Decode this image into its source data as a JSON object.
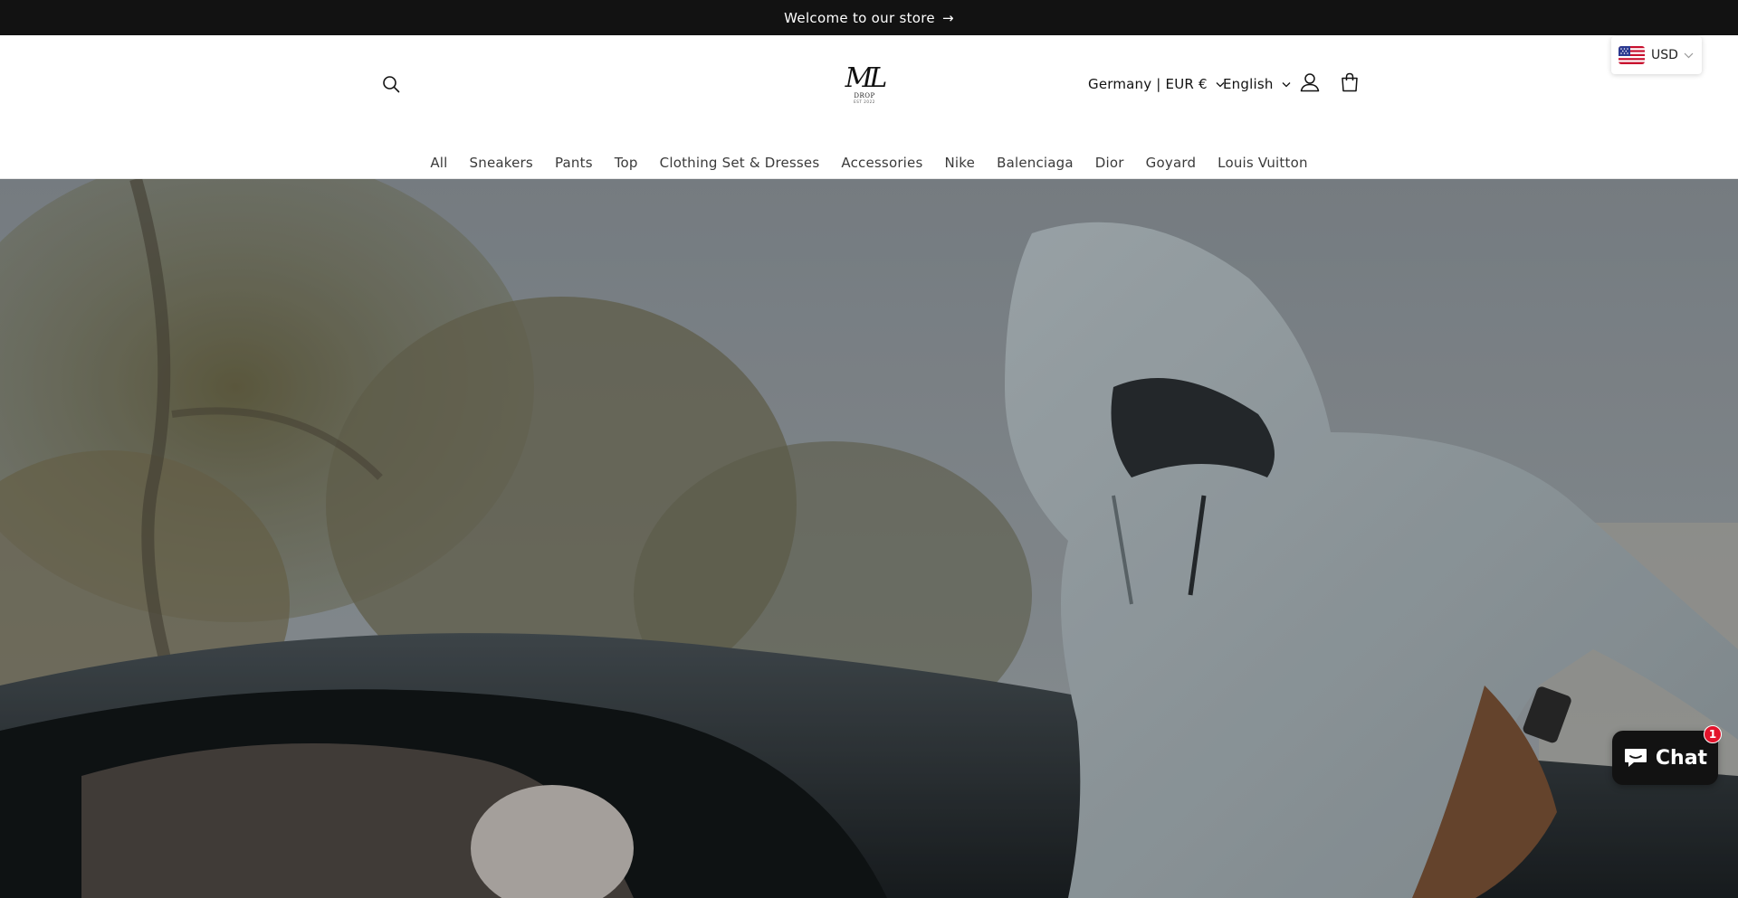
{
  "announcement": {
    "text": "Welcome to our store",
    "arrow": "→"
  },
  "header": {
    "logo": {
      "monogram": "ML",
      "name": "DROP",
      "tagline": "EST 2022"
    },
    "country_selector": "Germany | EUR €",
    "language_selector": "English",
    "icons": {
      "search": "search-icon",
      "account": "account-icon",
      "cart": "cart-icon"
    }
  },
  "nav": {
    "items": [
      {
        "label": "All"
      },
      {
        "label": "Sneakers"
      },
      {
        "label": "Pants"
      },
      {
        "label": "Top"
      },
      {
        "label": "Clothing Set & Dresses"
      },
      {
        "label": "Accessories"
      },
      {
        "label": "Nike"
      },
      {
        "label": "Balenciaga"
      },
      {
        "label": "Dior"
      },
      {
        "label": "Goyard"
      },
      {
        "label": "Louis Vuitton"
      }
    ]
  },
  "currency_widget": {
    "currency": "USD",
    "flag": "us-flag-icon"
  },
  "chat": {
    "label": "Chat",
    "badge": "1"
  },
  "colors": {
    "announcement_bg": "#121212",
    "chat_bg": "#121212",
    "badge_red": "#e3132b",
    "text": "#121212"
  }
}
